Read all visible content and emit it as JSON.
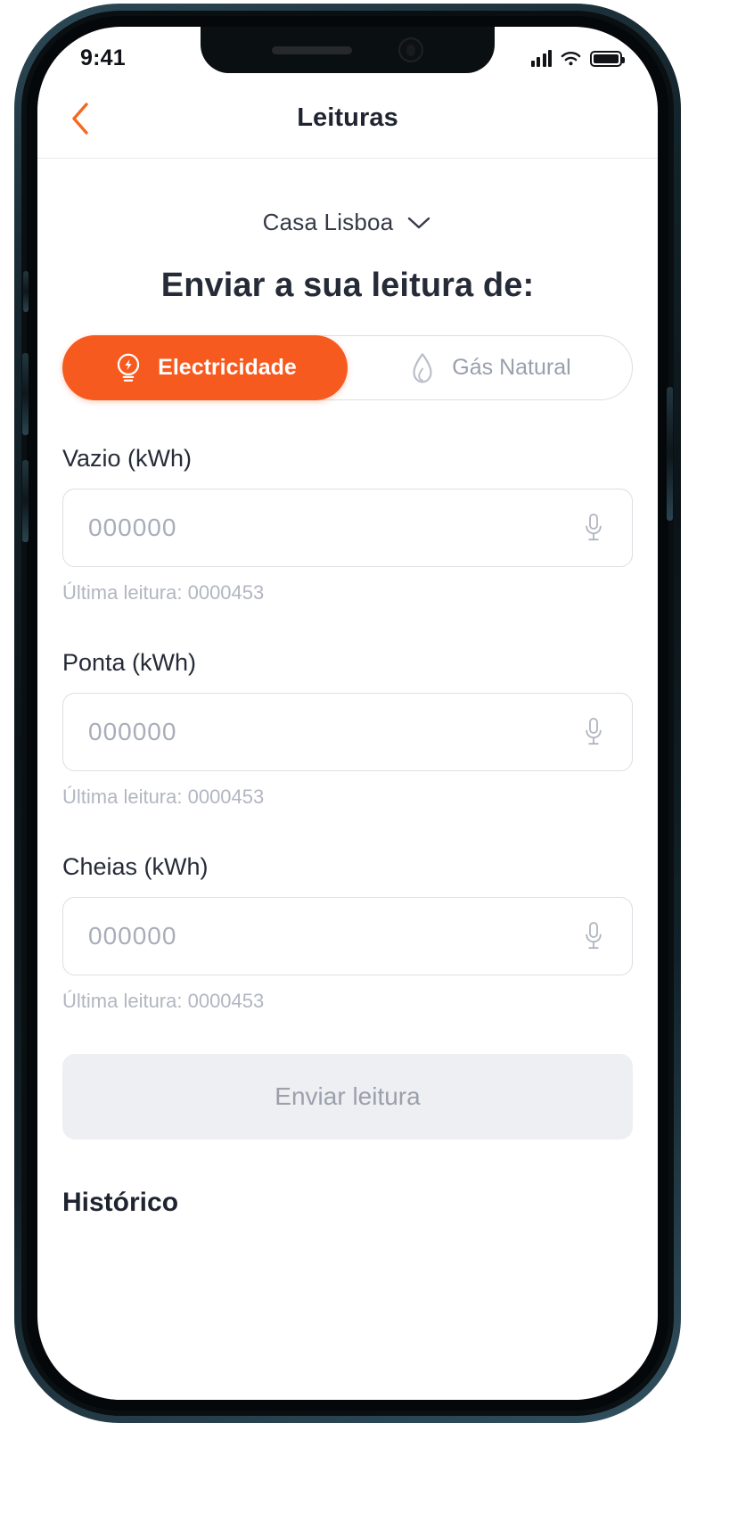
{
  "status_bar": {
    "time": "9:41",
    "signal_icon": "cellular-signal-icon",
    "wifi_icon": "wifi-icon",
    "battery_icon": "battery-icon"
  },
  "navbar": {
    "back_icon": "chevron-left-icon",
    "title": "Leituras"
  },
  "location": {
    "name": "Casa Lisboa",
    "chevron_icon": "chevron-down-icon"
  },
  "heading": "Enviar a sua leitura de:",
  "segmented": {
    "options": [
      {
        "label": "Electricidade",
        "icon": "lightbulb-bolt-icon",
        "active": true
      },
      {
        "label": "Gás Natural",
        "icon": "flame-icon",
        "active": false
      }
    ]
  },
  "fields": [
    {
      "label": "Vazio (kWh)",
      "value": "",
      "placeholder": "000000",
      "hint": "Última leitura: 0000453",
      "mic_icon": "microphone-icon"
    },
    {
      "label": "Ponta (kWh)",
      "value": "",
      "placeholder": "000000",
      "hint": "Última leitura: 0000453",
      "mic_icon": "microphone-icon"
    },
    {
      "label": "Cheias (kWh)",
      "value": "",
      "placeholder": "000000",
      "hint": "Última leitura: 0000453",
      "mic_icon": "microphone-icon"
    }
  ],
  "submit_button": {
    "label": "Enviar leitura",
    "enabled": false
  },
  "history": {
    "title": "Histórico"
  },
  "colors": {
    "accent": "#f75a1e",
    "text_dark": "#262b38",
    "text_muted": "#b2b6c1",
    "border": "#dcdee4",
    "disabled_bg": "#eeeff2"
  }
}
